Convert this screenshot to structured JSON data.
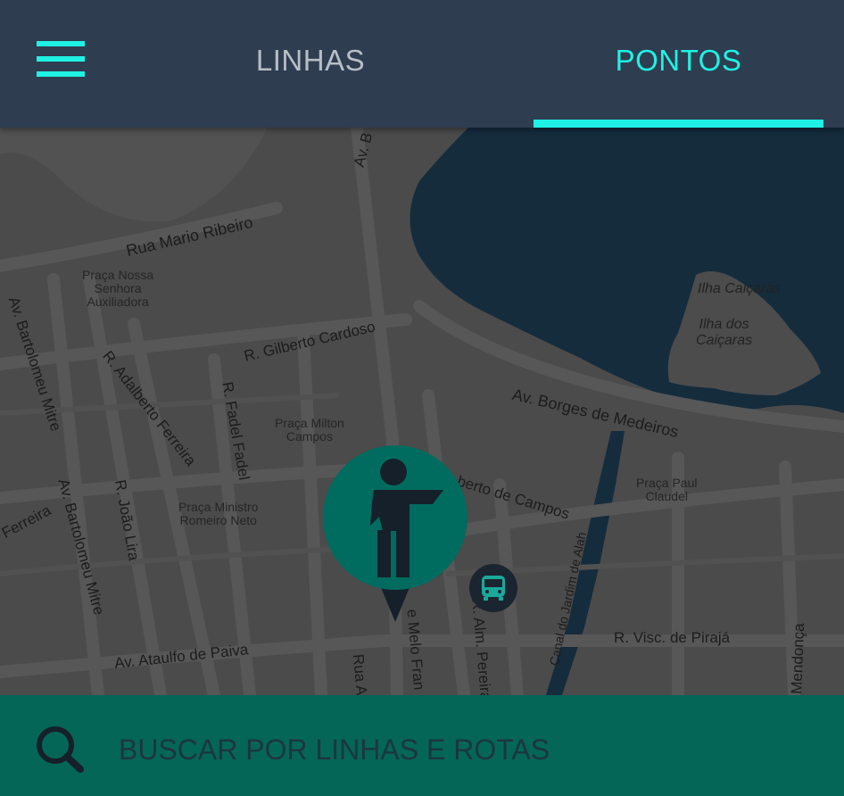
{
  "header": {
    "tabs": [
      {
        "label": "LINHAS",
        "active": false
      },
      {
        "label": "PONTOS",
        "active": true
      }
    ]
  },
  "map": {
    "streets": [
      "Rua Mario Ribeiro",
      "R. Gilberto Cardoso",
      "Av. Bartolomeu Mitre",
      "R. Adalberto Ferreira",
      "R. Fadel Fadel",
      "R. João Lira",
      "Av. Bartolomeu Mitre",
      "Ferreira",
      "Av. Ataulfo de Paiva",
      "Av. Borges de Medeiros",
      "berto de Campos",
      "R. Visc. de Pirajá",
      "Canal do Jardim de Alah",
      "R. Alm. Pereira",
      "e Melo Fran",
      "Rua Al",
      "Mendonça",
      "Av. B"
    ],
    "places": [
      "Praça Nossa\nSenhora\nAuxiliadora",
      "Praça Milton\nCampos",
      "Praça Ministro\nRomeiro Neto",
      "Praça Paul\nClaudel"
    ],
    "islands": [
      "Ilha Caiçaras",
      "Ilha dos\nCaiçaras"
    ]
  },
  "search": {
    "placeholder": "BUSCAR POR LINHAS E ROTAS"
  },
  "icons": {
    "menu": "hamburger-menu-icon",
    "pin": "person-hailing-icon",
    "bus": "bus-icon",
    "search": "magnifier-icon"
  },
  "colors": {
    "header_bg": "#2e3d50",
    "accent": "#1ff2e4",
    "search_bar_bg": "#046657",
    "pin_bg": "#006b5f",
    "lagoon": "#152c3d"
  }
}
